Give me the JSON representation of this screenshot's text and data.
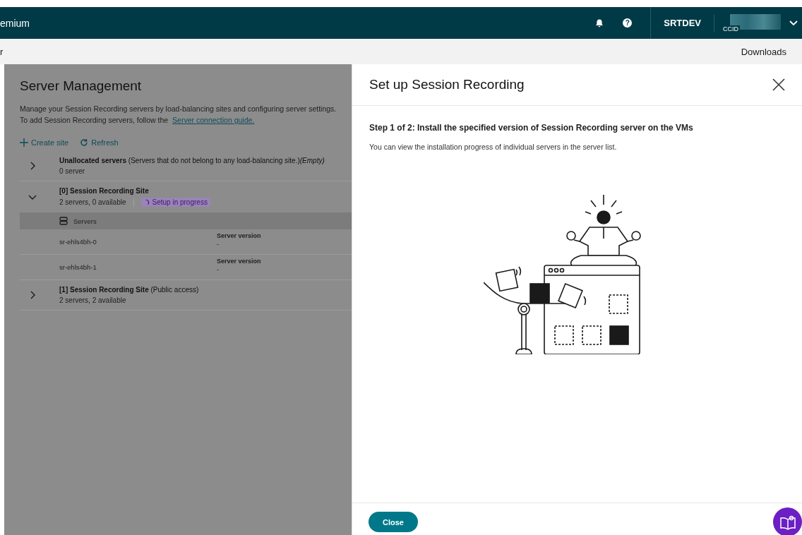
{
  "header": {
    "brand": "emium",
    "help_glyph": "?",
    "tenant": "SRTDEV",
    "account_label": "CCID"
  },
  "subheader": {
    "left": "r",
    "right": "Downloads"
  },
  "page": {
    "title": "Server Management",
    "description": "Manage your Session Recording servers by load-balancing sites and configuring server settings.",
    "guide_prefix": "To add Session Recording servers, follow the",
    "guide_link": "Server connection guide.",
    "actions": [
      {
        "kind": "create",
        "label": "Create site"
      },
      {
        "kind": "refresh",
        "label": "Refresh"
      }
    ],
    "sites": [
      {
        "name": "**Unallocated servers** (Servers that do not belong to any load-balancing site.)*(Empty)*",
        "summary": "0 server",
        "expanded": false
      },
      {
        "name": "**[0] Session Recording Site**",
        "summary": "2 servers, 0 available",
        "status": "Setup in progress",
        "expanded": true,
        "servers_header": "Servers",
        "servers": [
          {
            "name": "sr-ehls4bh-0",
            "version_label": "Server version",
            "version": "-"
          },
          {
            "name": "sr-ehls4bh-1",
            "version_label": "Server version",
            "version": "-"
          }
        ]
      },
      {
        "name": "**[1] Session Recording Site** (Public access)",
        "summary": "2 servers, 2 available",
        "expanded": false
      }
    ]
  },
  "drawer": {
    "title": "Set up Session Recording",
    "step": "Step 1 of 2: Install the specified version of Session Recording server on the VMs",
    "note": "You can view the installation progress of individual servers in the server list.",
    "close_button": "Close"
  }
}
